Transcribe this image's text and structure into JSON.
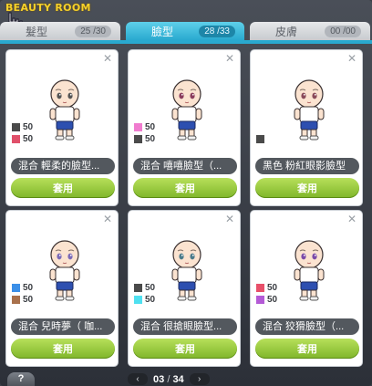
{
  "window": {
    "title": "BEAUTY ROOM"
  },
  "tabs": [
    {
      "label": "髮型",
      "count": "25 /30"
    },
    {
      "label": "臉型",
      "count": "28 /33"
    },
    {
      "label": "皮膚",
      "count": "00 /00"
    }
  ],
  "cards": [
    {
      "name": "混合 輕柔的臉型...",
      "swatches": [
        {
          "color": "#4a4a4a",
          "value": "50"
        },
        {
          "color": "#e0506a",
          "value": "50"
        }
      ],
      "eye_color": "#555555",
      "apply_label": "套用"
    },
    {
      "name": "混合 嘻嘻臉型（...",
      "swatches": [
        {
          "color": "#f07ccf",
          "value": "50"
        },
        {
          "color": "#4a4a4a",
          "value": "50"
        }
      ],
      "eye_color": "#8a3b5c",
      "apply_label": "套用"
    },
    {
      "name": "黑色 粉紅眼影臉型",
      "swatches": [
        {
          "color": "#4a4a4a",
          "value": ""
        }
      ],
      "eye_color": "#8a4a5a",
      "apply_label": "套用"
    },
    {
      "name": "混合 兒時夢（ 咖...",
      "swatches": [
        {
          "color": "#3b8fe8",
          "value": "50"
        },
        {
          "color": "#a9714c",
          "value": "50"
        }
      ],
      "eye_color": "#7a6ab8",
      "apply_label": "套用"
    },
    {
      "name": "混合 很搶眼臉型...",
      "swatches": [
        {
          "color": "#4a4a4a",
          "value": "50"
        },
        {
          "color": "#4fe0f0",
          "value": "50"
        }
      ],
      "eye_color": "#4a7a8a",
      "apply_label": "套用"
    },
    {
      "name": "混合 狡猾臉型（...",
      "swatches": [
        {
          "color": "#e8506a",
          "value": "50"
        },
        {
          "color": "#b45ad6",
          "value": "50"
        }
      ],
      "eye_color": "#7a4aa8",
      "apply_label": "套用"
    }
  ],
  "footer": {
    "help_label": "?",
    "prev_label": "‹",
    "next_label": "›",
    "page_current": "03",
    "page_sep": "/",
    "page_total": "34"
  }
}
